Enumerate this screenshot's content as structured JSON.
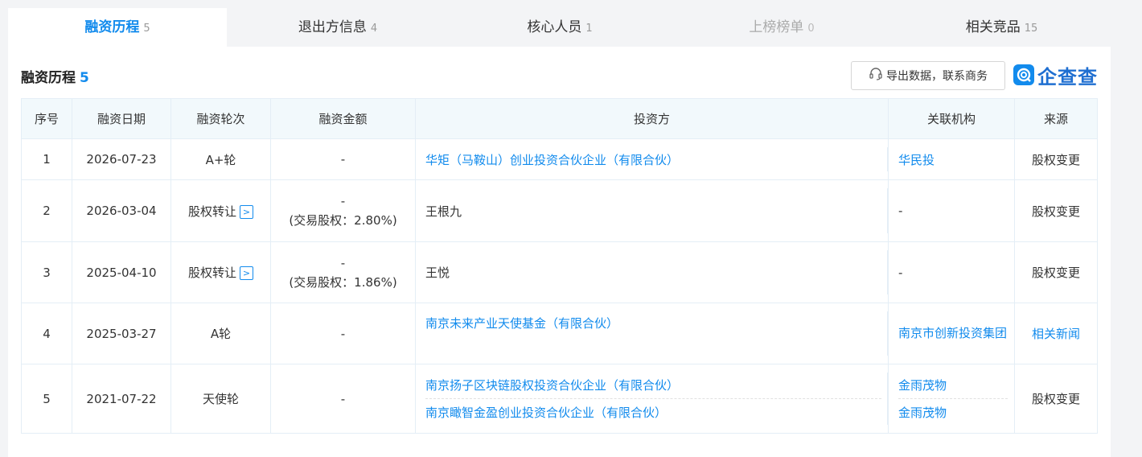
{
  "tabs": [
    {
      "label": "融资历程",
      "count": "5",
      "active": true
    },
    {
      "label": "退出方信息",
      "count": "4"
    },
    {
      "label": "核心人员",
      "count": "1"
    },
    {
      "label": "上榜榜单",
      "count": "0",
      "disabled": true
    },
    {
      "label": "相关竞品",
      "count": "15"
    }
  ],
  "section": {
    "title": "融资历程",
    "count": "5"
  },
  "export_button": {
    "label": "导出数据，联系商务",
    "icon": "headset-icon"
  },
  "logo": {
    "text": "企查查",
    "icon": "qcc-logo-icon"
  },
  "table": {
    "headers": [
      "序号",
      "融资日期",
      "融资轮次",
      "融资金额",
      "投资方",
      "关联机构",
      "来源"
    ],
    "rows": [
      {
        "seq": "1",
        "date": "2026-07-23",
        "round": "A+轮",
        "amount": "-",
        "investors": [
          "华矩（马鞍山）创业投资合伙企业（有限合伙）"
        ],
        "orgs": [
          "华民投"
        ],
        "source": "股权变更"
      },
      {
        "seq": "2",
        "date": "2026-03-04",
        "round": "股权转让",
        "amount": "-",
        "amount_note": "(交易股权：2.80%)",
        "investors": [
          "王根九"
        ],
        "orgs": [
          "-"
        ],
        "source": "股权变更"
      },
      {
        "seq": "3",
        "date": "2025-04-10",
        "round": "股权转让",
        "amount": "-",
        "amount_note": "(交易股权：1.86%)",
        "investors": [
          "王悦"
        ],
        "orgs": [
          "-"
        ],
        "source": "股权变更"
      },
      {
        "seq": "4",
        "date": "2025-03-27",
        "round": "A轮",
        "amount": "-",
        "investors": [
          "南京未来产业天使基金（有限合伙）"
        ],
        "orgs": [
          "南京市创新投资集团"
        ],
        "source": "相关新闻"
      },
      {
        "seq": "5",
        "date": "2021-07-22",
        "round": "天使轮",
        "amount": "-",
        "investors": [
          "南京扬子区块链股权投资合伙企业（有限合伙）",
          "南京瞰智金盈创业投资合伙企业（有限合伙）"
        ],
        "orgs": [
          "金雨茂物",
          "金雨茂物"
        ],
        "source": "股权变更"
      }
    ]
  },
  "colors": {
    "accent": "#128bed",
    "header_bg": "#f2f9fc",
    "border": "#e4eef6"
  }
}
